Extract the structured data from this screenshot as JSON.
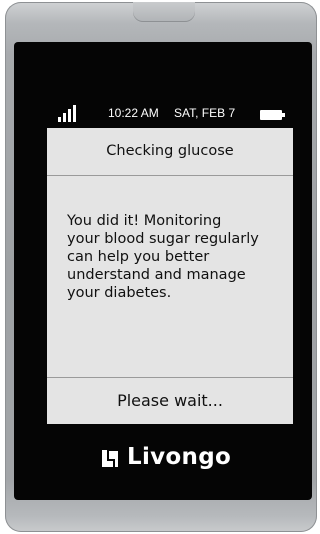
{
  "status_bar": {
    "time": "10:22 AM",
    "date": "SAT, FEB 7",
    "signal_icon": "signal-bars-icon",
    "battery_icon": "battery-full-icon"
  },
  "screen": {
    "title": "Checking glucose",
    "message": "You did it! Monitoring\nyour blood sugar regularly\ncan help you better\nunderstand and manage\nyour diabetes.",
    "footer": "Please wait..."
  },
  "brand": {
    "name": "Livongo",
    "logo_icon": "livongo-logo-icon"
  },
  "colors": {
    "screen_bg": "#e4e4e4",
    "bezel": "#050505",
    "device_shell": "#a7aaad"
  }
}
